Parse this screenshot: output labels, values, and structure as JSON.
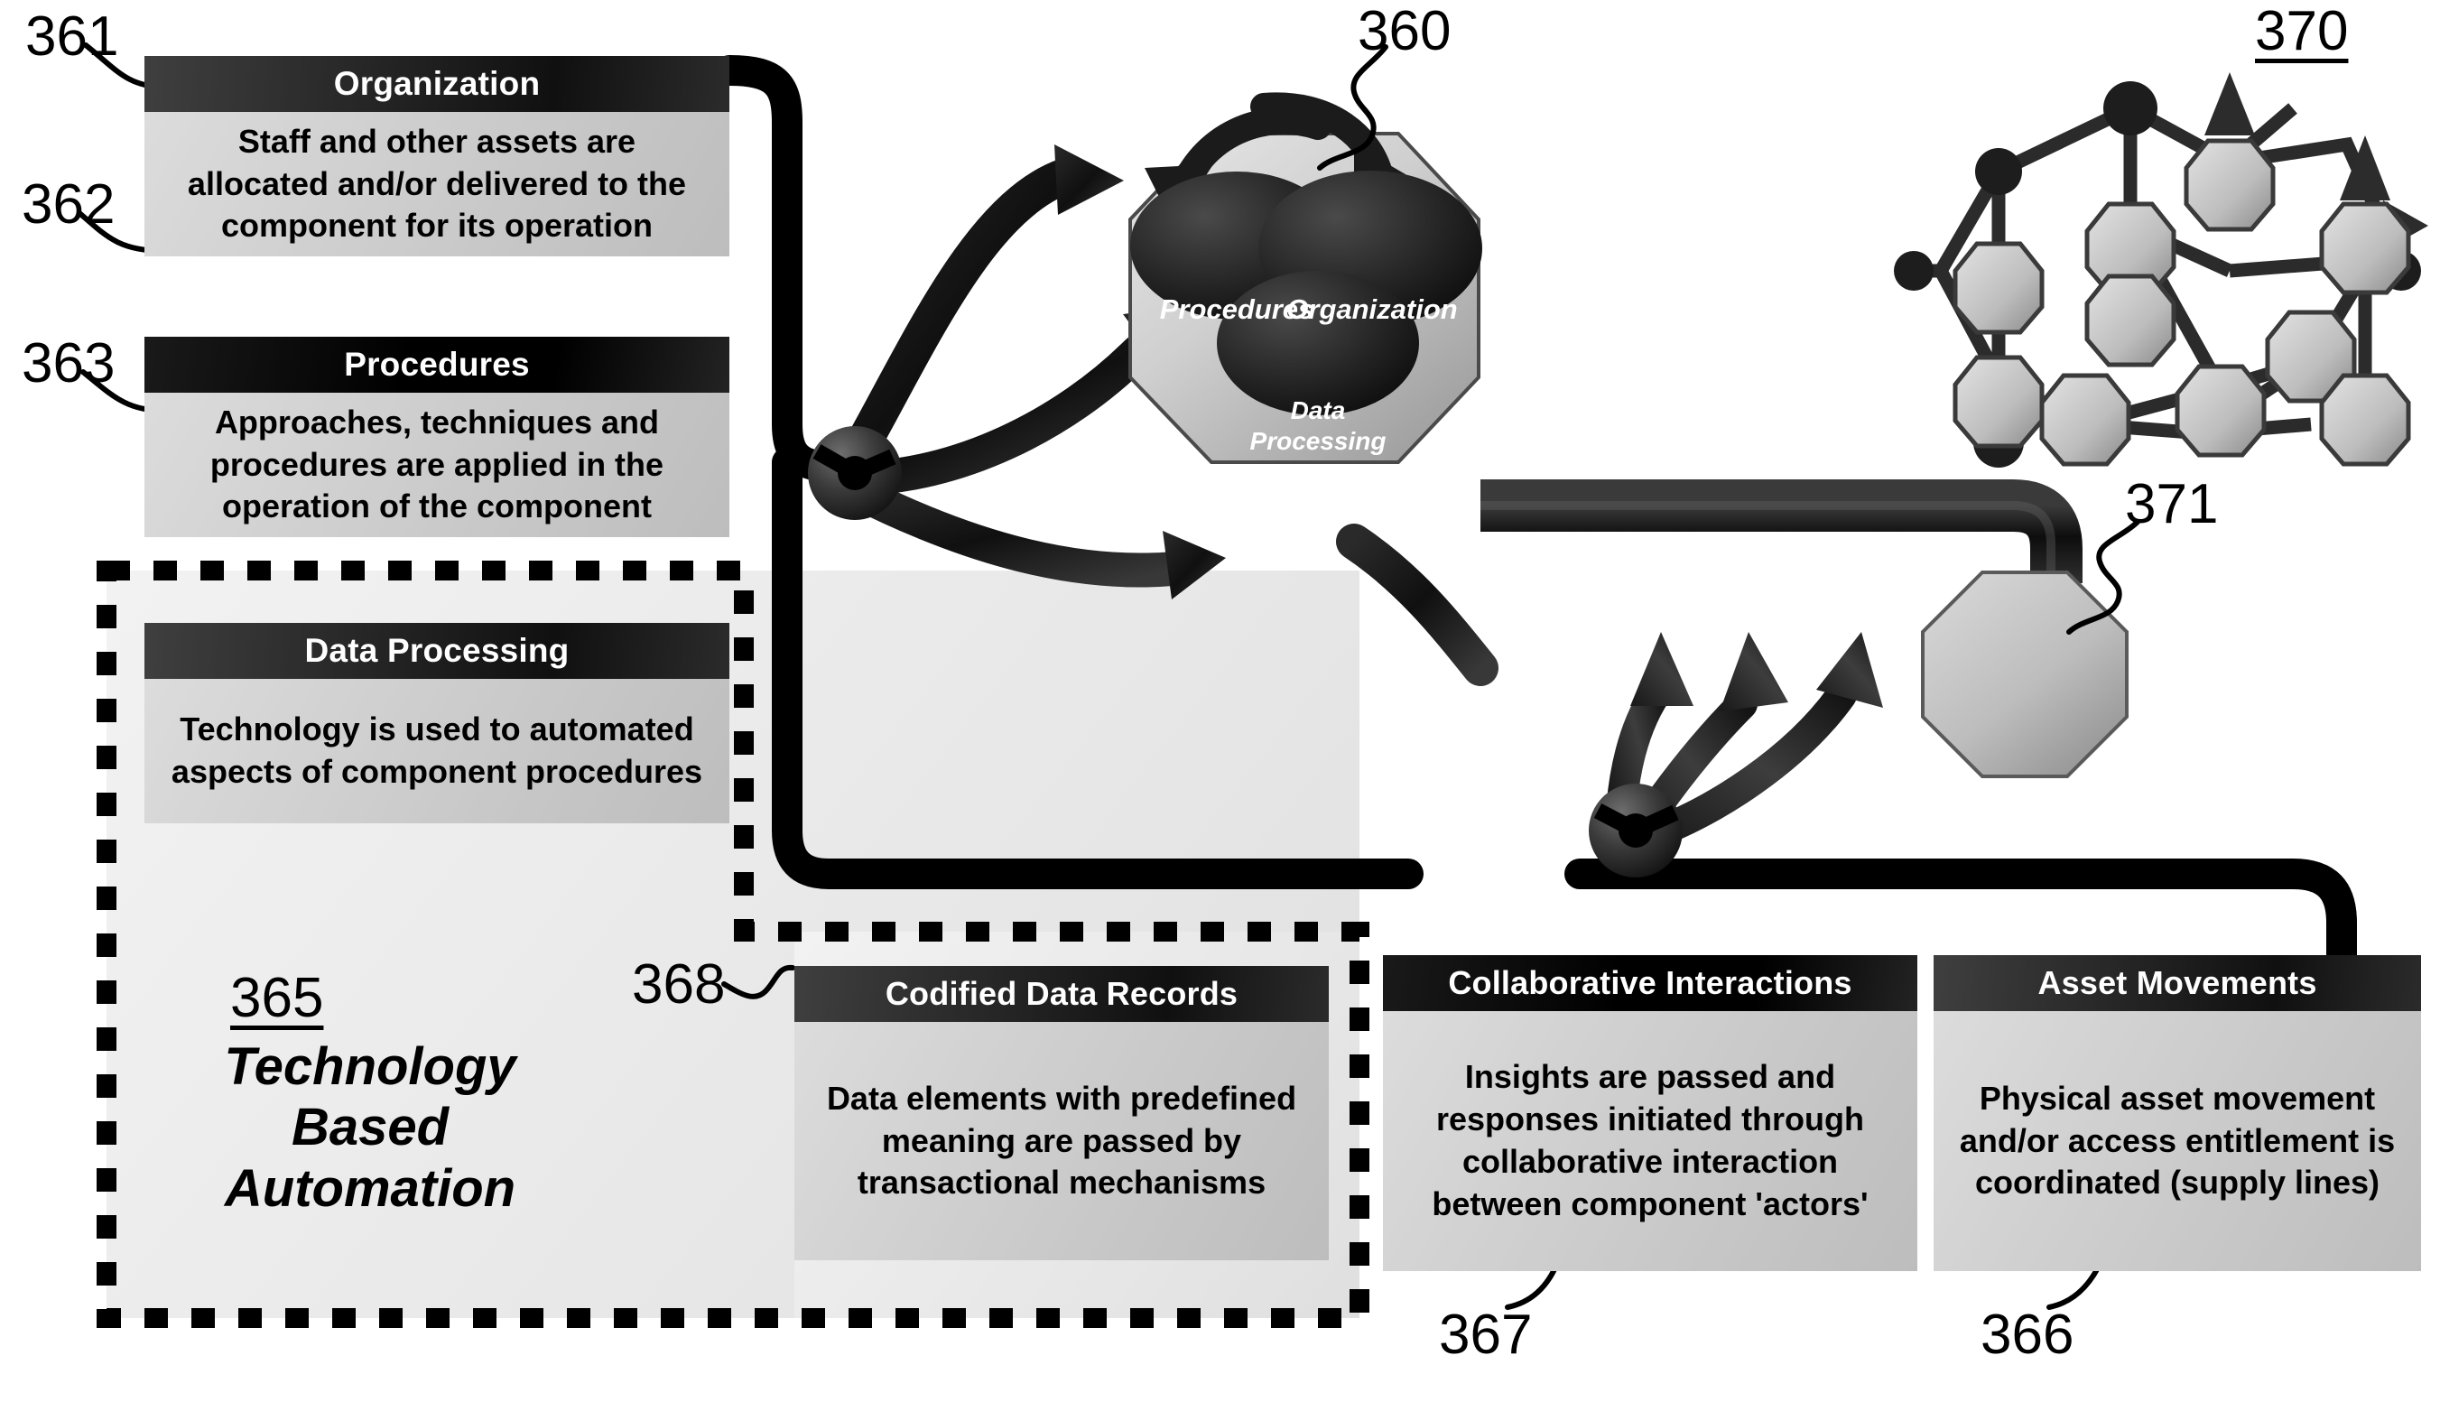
{
  "figure": {
    "refs": {
      "r360": "360",
      "r361": "361",
      "r362": "362",
      "r363": "363",
      "r365": "365",
      "r366": "366",
      "r367": "367",
      "r368": "368",
      "r370": "370",
      "r371": "371"
    },
    "colors": {
      "header_dark": "#1a1a1a",
      "header_black": "#000000",
      "body_grey": "#cccccc",
      "panel_grey": "#e9e9e9",
      "ink": "#000000",
      "paper": "#ffffff"
    }
  },
  "cards": {
    "organization": {
      "title": "Organization",
      "body": "Staff and other assets are allocated and/or delivered to the component for its operation"
    },
    "procedures": {
      "title": "Procedures",
      "body": "Approaches, techniques and procedures are applied in the operation of the component"
    },
    "data_processing": {
      "title": "Data Processing",
      "body": "Technology is used to automated aspects of component procedures"
    },
    "codified_data_records": {
      "title": "Codified Data Records",
      "body": "Data elements with predefined meaning are passed by transactional mechanisms"
    },
    "collaborative_interactions": {
      "title": "Collaborative Interactions",
      "body": "Insights are passed and responses initiated through collaborative interaction between component 'actors'"
    },
    "asset_movements": {
      "title": "Asset Movements",
      "body": "Physical asset movement and/or access entitlement is coordinated (supply lines)"
    }
  },
  "automation_block": {
    "ref": "365",
    "line1": "Technology",
    "line2": "Based",
    "line3": "Automation"
  },
  "octagon_hub": {
    "ref": "360",
    "lobes": [
      {
        "name": "Procedures",
        "label": "Procedures"
      },
      {
        "name": "Organization",
        "label": "Organization"
      },
      {
        "name": "Data Processing",
        "label_line1": "Data",
        "label_line2": "Processing"
      }
    ]
  },
  "network_graph": {
    "ref": "370",
    "description": "node-and-link mesh of interconnected components"
  },
  "single_node": {
    "ref": "371",
    "shape": "octagon"
  }
}
